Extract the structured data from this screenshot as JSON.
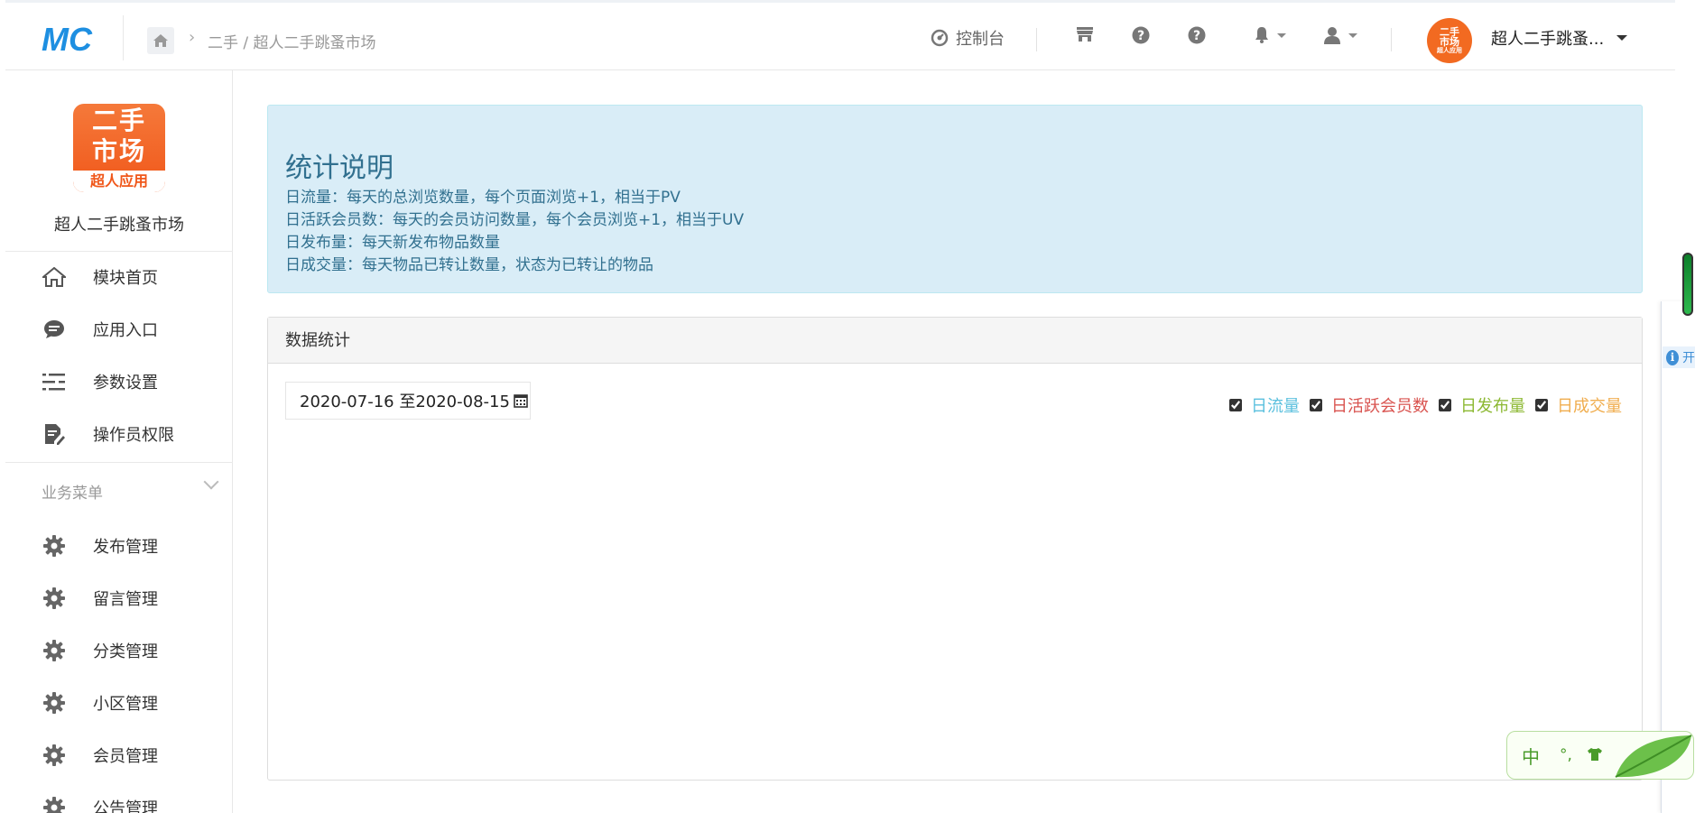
{
  "header": {
    "logo_text": "MC",
    "breadcrumb": "二手 / 超人二手跳蚤市场",
    "console_label": "控制台",
    "account_name": "超人二手跳蚤...",
    "avatar": {
      "line1": "二手",
      "line2": "市场",
      "line3": "超人应用"
    },
    "icons": [
      "home-icon",
      "dashboard-icon",
      "store-icon",
      "help-icon",
      "help-icon",
      "bell-icon",
      "user-icon"
    ]
  },
  "sidebar": {
    "app_logo": {
      "line1": "二手",
      "line2": "市场",
      "line3": "超人应用"
    },
    "app_name": "超人二手跳蚤市场",
    "items": [
      {
        "label": "模块首页",
        "icon": "home-icon"
      },
      {
        "label": "应用入口",
        "icon": "chat-icon"
      },
      {
        "label": "参数设置",
        "icon": "sliders-icon"
      },
      {
        "label": "操作员权限",
        "icon": "edit-doc-icon"
      }
    ],
    "section_title": "业务菜单",
    "business_items": [
      {
        "label": "发布管理",
        "icon": "gear-icon"
      },
      {
        "label": "留言管理",
        "icon": "gear-icon"
      },
      {
        "label": "分类管理",
        "icon": "gear-icon"
      },
      {
        "label": "小区管理",
        "icon": "gear-icon"
      },
      {
        "label": "会员管理",
        "icon": "gear-icon"
      },
      {
        "label": "公告管理",
        "icon": "gear-icon"
      }
    ]
  },
  "notice": {
    "title": "统计说明",
    "lines": [
      "日流量：每天的总浏览数量，每个页面浏览+1，相当于PV",
      "日活跃会员数：每天的会员访问数量，每个会员浏览+1，相当于UV",
      "日发布量：每天新发布物品数量",
      "日成交量：每天物品已转让数量，状态为已转让的物品"
    ],
    "colors": {
      "background": "#d9edf7",
      "text": "#31708f"
    }
  },
  "stats_panel": {
    "title": "数据统计",
    "date_range": "2020-07-16 至2020-08-15",
    "legend": [
      {
        "label": "日流量",
        "checked": true,
        "color": "#5bc0de"
      },
      {
        "label": "日活跃会员数",
        "checked": true,
        "color": "#d9534f"
      },
      {
        "label": "日发布量",
        "checked": true,
        "color": "#8cb832"
      },
      {
        "label": "日成交量",
        "checked": true,
        "color": "#f0ad4e"
      }
    ]
  },
  "side_widget": {
    "info_text": "开"
  },
  "ime": {
    "mode": "中",
    "punct": "°,"
  }
}
